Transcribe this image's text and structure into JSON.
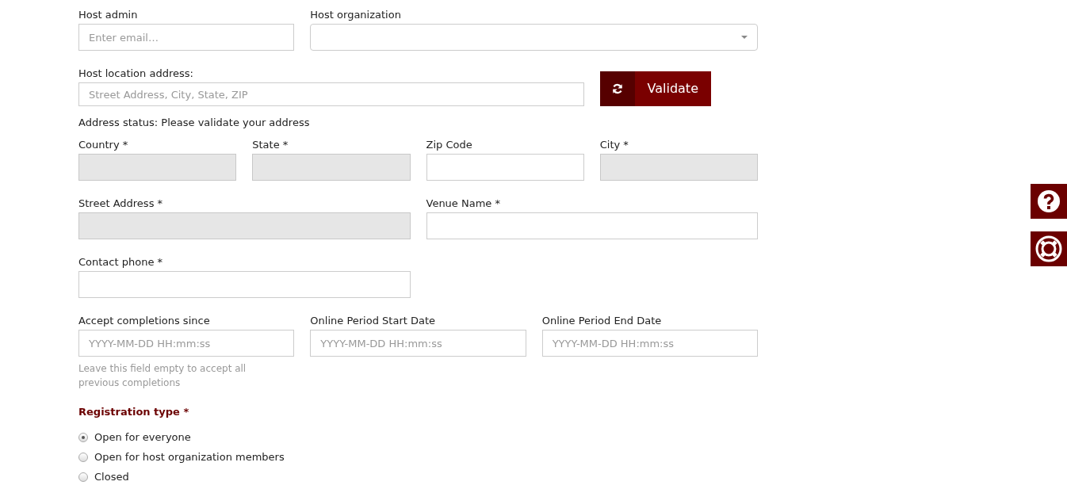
{
  "host_admin": {
    "label": "Host admin",
    "placeholder": "Enter email…"
  },
  "host_organization": {
    "label": "Host organization"
  },
  "host_location": {
    "label": "Host location address:",
    "placeholder": "Street Address, City, State, ZIP"
  },
  "validate_button": {
    "label": "Validate"
  },
  "address_status": "Address status: Please validate your address",
  "address_rows": [
    [
      {
        "label": "Country *",
        "disabled": true
      },
      {
        "label": "State *",
        "disabled": true
      },
      {
        "label": "Zip Code",
        "disabled": false
      },
      {
        "label": "City *",
        "disabled": true
      }
    ],
    [
      {
        "label": "Street Address *",
        "disabled": true
      },
      {
        "label": "Venue Name *",
        "disabled": false
      }
    ],
    [
      {
        "label": "Contact phone *",
        "disabled": false
      }
    ]
  ],
  "dates": [
    {
      "label": "Accept completions since",
      "placeholder": "YYYY-MM-DD HH:mm:ss",
      "help": "Leave this field empty to accept all previous completions"
    },
    {
      "label": "Online Period Start Date",
      "placeholder": "YYYY-MM-DD HH:mm:ss"
    },
    {
      "label": "Online Period End Date",
      "placeholder": "YYYY-MM-DD HH:mm:ss"
    }
  ],
  "registration_type": {
    "label": "Registration type *",
    "options": [
      {
        "label": "Open for everyone",
        "selected": true
      },
      {
        "label": "Open for host organization members",
        "selected": false
      },
      {
        "label": "Closed",
        "selected": false
      }
    ]
  },
  "side_buttons": [
    {
      "kind": "help"
    },
    {
      "kind": "support"
    }
  ]
}
